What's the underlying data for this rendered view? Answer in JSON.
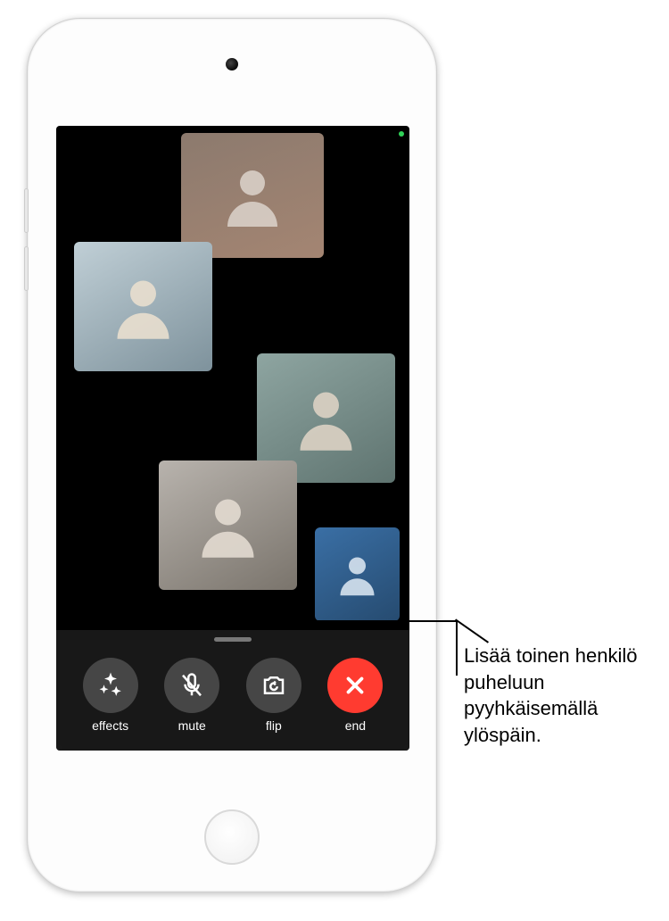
{
  "controls": {
    "effects": "effects",
    "mute": "mute",
    "flip": "flip",
    "end": "end"
  },
  "callout": "Lisää toinen henkilö puheluun pyyhkäisemällä ylöspäin.",
  "tiles": [
    "participant-1",
    "participant-2",
    "participant-3",
    "participant-4",
    "participant-self"
  ]
}
